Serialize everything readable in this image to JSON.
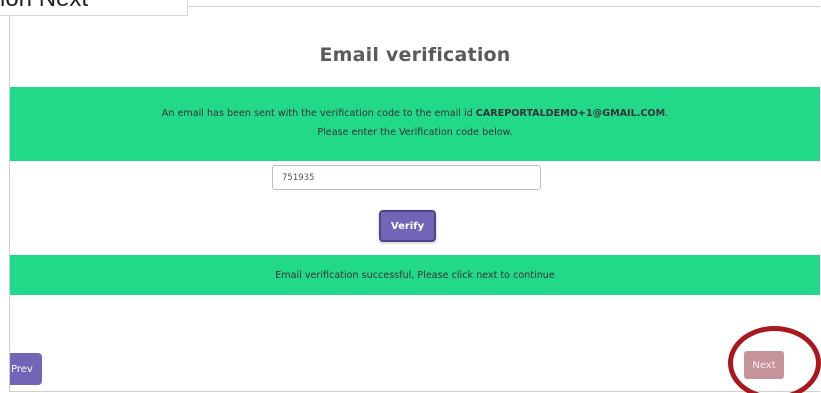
{
  "callout": {
    "label": "ion Next"
  },
  "page": {
    "title": "Email verification"
  },
  "info_banner": {
    "line1_prefix": "An email has been sent with the verification code to the email id ",
    "email": "CAREPORTALDEMO+1@GMAIL.COM",
    "line1_suffix": ".",
    "line2": "Please enter the Verification code below."
  },
  "code_input": {
    "value": "751935"
  },
  "verify_button": {
    "label": "Verify"
  },
  "success_banner": {
    "text": "Email verification successful, Please click next to continue"
  },
  "nav": {
    "prev_label": "Prev",
    "next_label": "Next"
  },
  "colors": {
    "banner_green": "#22d98a",
    "button_purple": "#7165b8",
    "next_disabled_pink": "#c7939b",
    "annotation_ring": "#a8181e"
  }
}
